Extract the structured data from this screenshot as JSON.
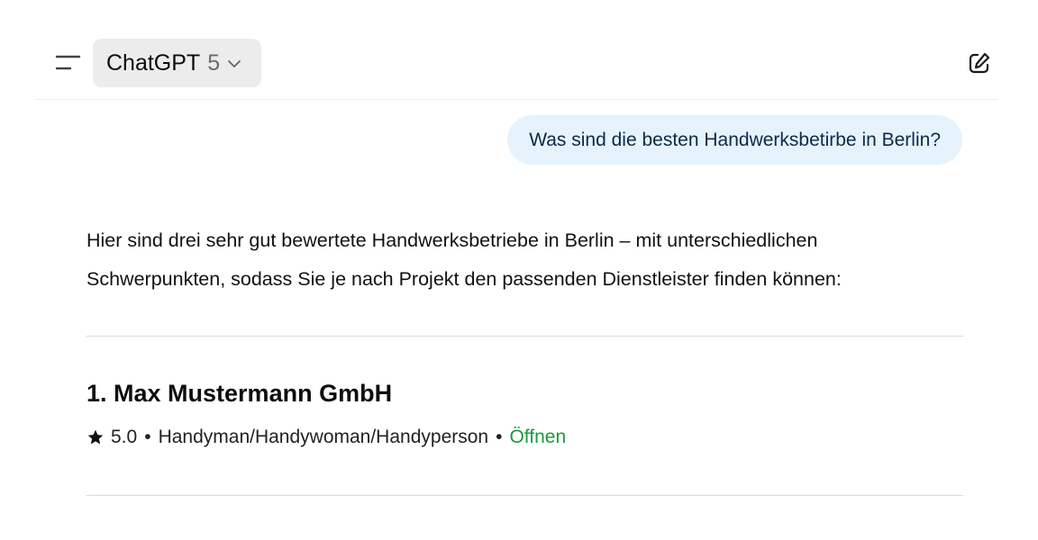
{
  "header": {
    "model_name": "ChatGPT",
    "model_version": "5",
    "icons": [
      "sidebar-toggle-icon",
      "chevron-down-icon",
      "new-chat-icon"
    ]
  },
  "conversation": {
    "user_message": "Was sind die besten Handwerksbetirbe in Berlin?",
    "assistant_intro_line1": "Hier sind drei sehr gut bewertete Handwerksbetriebe in Berlin – mit unterschiedlichen",
    "assistant_intro_line2": "Schwerpunkten, sodass Sie je nach Projekt den passenden Dienstleister finden können:",
    "businesses": [
      {
        "title": "1. Max Mustermann GmbH",
        "rating": "5.0",
        "separator": "•",
        "category": "Handyman/Handywoman/Handyperson",
        "status": "Öffnen"
      }
    ]
  },
  "colors": {
    "user_bubble_bg": "#e6f2fc",
    "status_open": "#1a9a3c",
    "model_picker_bg": "#ececec"
  }
}
